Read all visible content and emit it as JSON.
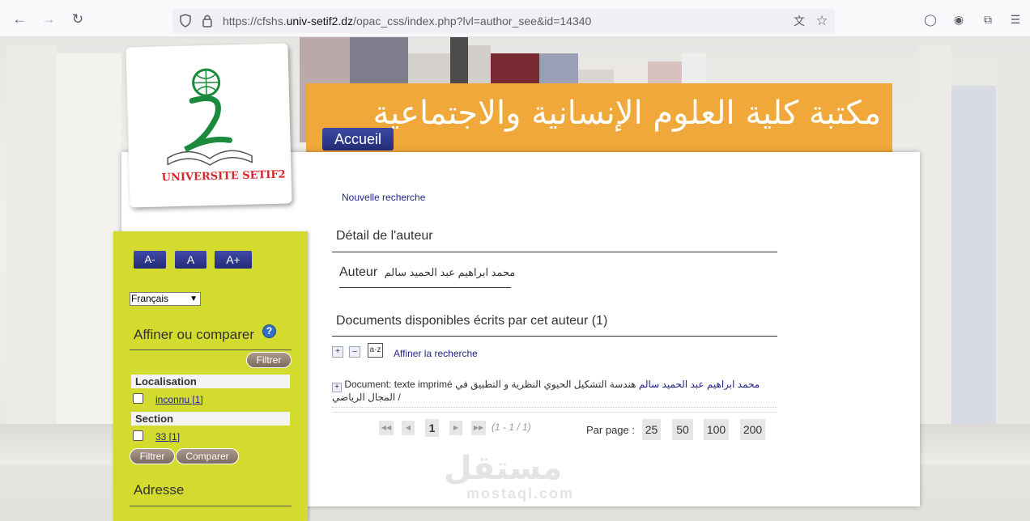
{
  "browser": {
    "url_prefix": "https://cfshs.",
    "url_domain": "univ-setif2.dz",
    "url_path": "/opac_css/index.php?lvl=author_see&id=14340"
  },
  "header": {
    "banner_title": "مكتبة كلية العلوم الإنسانية والاجتماعية",
    "accueil_label": "Accueil",
    "logo_text": "UNIVERSITE SETIF2",
    "brand_color": "#f0a83a"
  },
  "sidebar": {
    "font_smaller": "A-",
    "font_normal": "A",
    "font_larger": "A+",
    "language": "Français",
    "refine_heading": "Affiner ou comparer",
    "filter_label": "Filtrer",
    "facets": [
      {
        "heading": "Localisation",
        "item": "inconnu [1]"
      },
      {
        "heading": "Section",
        "item": "33 [1]"
      }
    ],
    "filter2_label": "Filtrer",
    "compare_label": "Comparer",
    "address_heading": "Adresse",
    "sidebar_color": "#d3dc2e"
  },
  "main": {
    "new_search": "Nouvelle recherche",
    "author_detail_heading": "Détail de l'auteur",
    "author_label": "Auteur",
    "author_name": "محمد ابراهيم عبد الحميد سالم",
    "documents_heading": "Documents disponibles écrits par cet auteur (1)",
    "refine_search": "Affiner la recherche",
    "sort_icon_label": "a·z",
    "document": {
      "type": "Document: texte imprimé",
      "title": "هندسة التشكيل الحيوي النظرية و التطبيق في المجال الرياضي /",
      "author_link": "محمد ابراهيم عبد الحميد سالم"
    },
    "pagination": {
      "current_page": "1",
      "range": "(1 - 1 / 1)",
      "per_page_label": "Par page :",
      "per_page_options": [
        "25",
        "50",
        "100",
        "200"
      ]
    }
  },
  "watermark": {
    "arabic": "مستقل",
    "latin": "mostaql.com"
  }
}
